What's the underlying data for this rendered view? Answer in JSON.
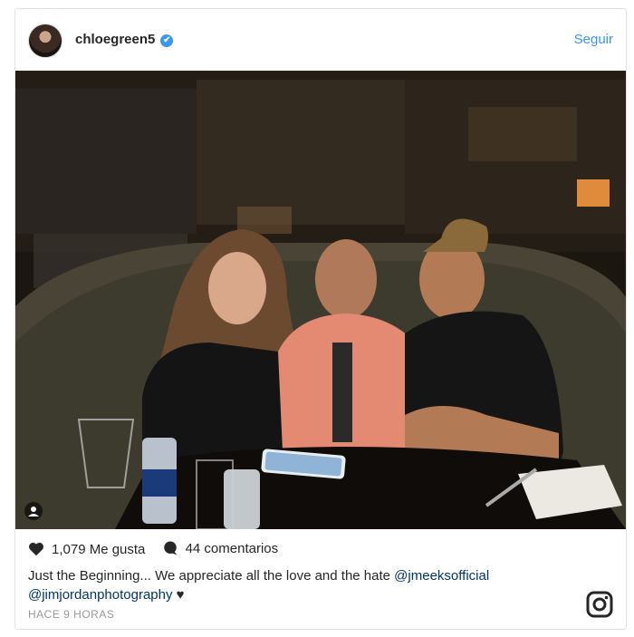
{
  "post": {
    "username": "chloegreen5",
    "verified_mark": "✔",
    "follow_label": "Seguir",
    "likes_text": "1,079 Me gusta",
    "comments_text": "44 comentarios",
    "caption_text": "Just the Beginning... We appreciate all the love and the hate ",
    "mention_1": "@jmeeksofficial",
    "mention_2": "@jimjordanphotography",
    "caption_end": " ♥",
    "timestamp": "HACE 9 HORAS"
  },
  "icons": {
    "verified": "verified-badge-icon",
    "like": "heart-icon",
    "comment": "comment-bubble-icon",
    "brand": "instagram-logo-icon",
    "multi": "tagged-people-icon"
  },
  "colors": {
    "accent": "#3897f0",
    "mention": "#003569",
    "muted": "#999999",
    "text": "#262626"
  }
}
